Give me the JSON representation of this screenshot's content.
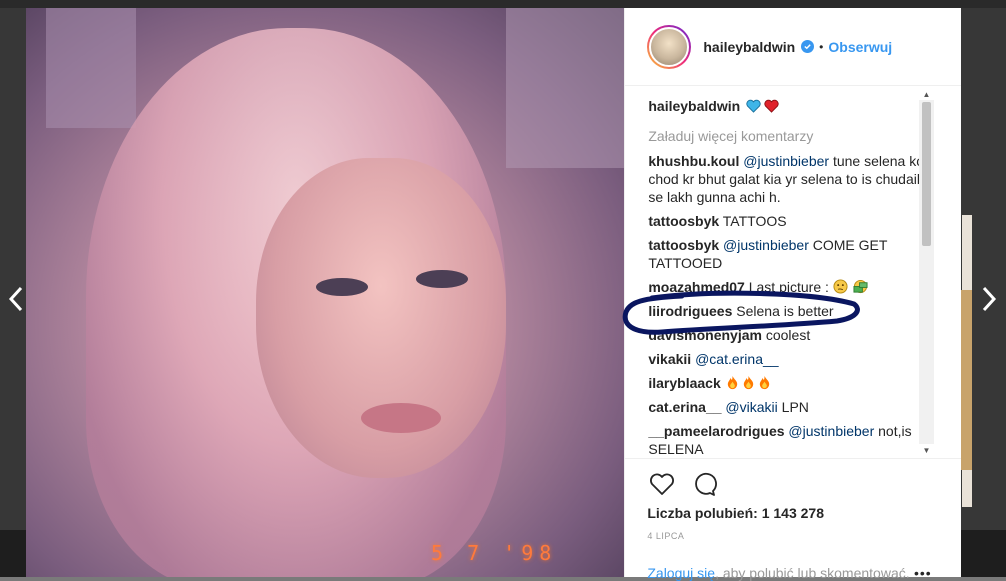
{
  "header": {
    "username": "haileybaldwin",
    "separator": "•",
    "follow_label": "Obserwuj"
  },
  "caption": {
    "username": "haileybaldwin",
    "emoji": [
      "blue-heart",
      "red-heart"
    ]
  },
  "load_more_label": "Załaduj więcej komentarzy",
  "comments": [
    {
      "user": "khushbu.koul",
      "mention": "@justinbieber",
      "text": " tune selena ko chod kr bhut galat kia yr selena to is chudail se lakh gunna achi h."
    },
    {
      "user": "tattoosbyk",
      "mention": "",
      "text": "TATTOOS"
    },
    {
      "user": "tattoosbyk",
      "mention": "@justinbieber",
      "text": " COME GET TATTOOED"
    },
    {
      "user": "moazahmed07",
      "mention": "",
      "text": "Last picture : ",
      "emoji": [
        "thinking-face",
        "money-face"
      ]
    },
    {
      "user": "liirodriguees",
      "mention": "",
      "text": "Selena is better"
    },
    {
      "user": "davismonenyjam",
      "mention": "",
      "text": "coolest"
    },
    {
      "user": "vikakii",
      "mention": "@cat.erina__",
      "text": ""
    },
    {
      "user": "ilaryblaack",
      "mention": "",
      "text": "",
      "emoji": [
        "fire",
        "fire",
        "fire"
      ]
    },
    {
      "user": "cat.erina__",
      "mention": "@vikakii",
      "text": " LPN"
    },
    {
      "user": "__pameelarodrigues",
      "mention": "@justinbieber",
      "text": " not,is SELENA"
    }
  ],
  "photo": {
    "datestamp": "5 7 '98"
  },
  "likes": {
    "label": "Liczba polubień:",
    "count": "1 143 278"
  },
  "date": "4 LIPCA",
  "login": {
    "link": "Zaloguj się",
    "text": ", aby polubić lub skomentować."
  },
  "more_label": "•••",
  "colors": {
    "link_blue": "#3897f0",
    "mention": "#003569",
    "scribble": "#0a1660"
  }
}
